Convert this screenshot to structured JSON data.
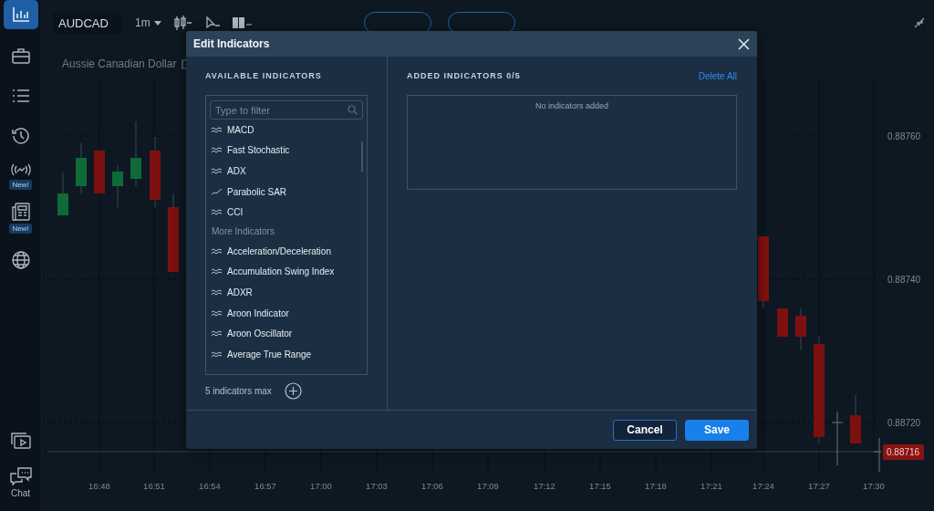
{
  "sidebar": {
    "items": [
      {
        "selected": true
      },
      {
        "selected": false
      },
      {
        "selected": false
      },
      {
        "selected": false
      },
      {
        "selected": false,
        "badge": "New!"
      },
      {
        "selected": false,
        "badge": "New!"
      },
      {
        "selected": false
      }
    ],
    "bottom_items": [
      {
        "kind": "video"
      },
      {
        "kind": "chat",
        "label": "Chat"
      }
    ]
  },
  "toolbar": {
    "symbol": "AUDCAD",
    "timeframe": "1m"
  },
  "instrument_name": "Aussie Canadian Dollar",
  "chart": {
    "price_labels": [
      "0.88760",
      "0.88740",
      "0.88720"
    ],
    "current_price": "0.88716",
    "time_labels": [
      "16:48",
      "16:51",
      "16:54",
      "16:57",
      "17:00",
      "17:03",
      "17:06",
      "17:09",
      "17:12",
      "17:15",
      "17:18",
      "17:21",
      "17:24",
      "17:27",
      "17:30"
    ]
  },
  "dialog": {
    "title": "Edit Indicators",
    "available": {
      "heading": "AVAILABLE INDICATORS",
      "filter_placeholder": "Type to filter",
      "items": [
        {
          "kind": "oscillator",
          "label": "MACD"
        },
        {
          "kind": "oscillator",
          "label": "Fast Stochastic"
        },
        {
          "kind": "oscillator",
          "label": "ADX"
        },
        {
          "kind": "overlay",
          "label": "Parabolic SAR"
        },
        {
          "kind": "oscillator",
          "label": "CCI"
        },
        {
          "kind": "heading",
          "label": "More Indicators"
        },
        {
          "kind": "oscillator",
          "label": "Acceleration/Deceleration"
        },
        {
          "kind": "oscillator",
          "label": "Accumulation Swing Index"
        },
        {
          "kind": "oscillator",
          "label": "ADXR"
        },
        {
          "kind": "oscillator",
          "label": "Aroon Indicator"
        },
        {
          "kind": "oscillator",
          "label": "Aroon Oscillator"
        },
        {
          "kind": "oscillator",
          "label": "Average True Range"
        }
      ],
      "max_note": "5 indicators max"
    },
    "added": {
      "heading": "ADDED INDICATORS 0/5",
      "delete_all": "Delete All",
      "empty_text": "No indicators added"
    },
    "buttons": [
      {
        "kind": "secondary",
        "label": "Cancel"
      },
      {
        "kind": "primary",
        "label": "Save"
      }
    ]
  }
}
